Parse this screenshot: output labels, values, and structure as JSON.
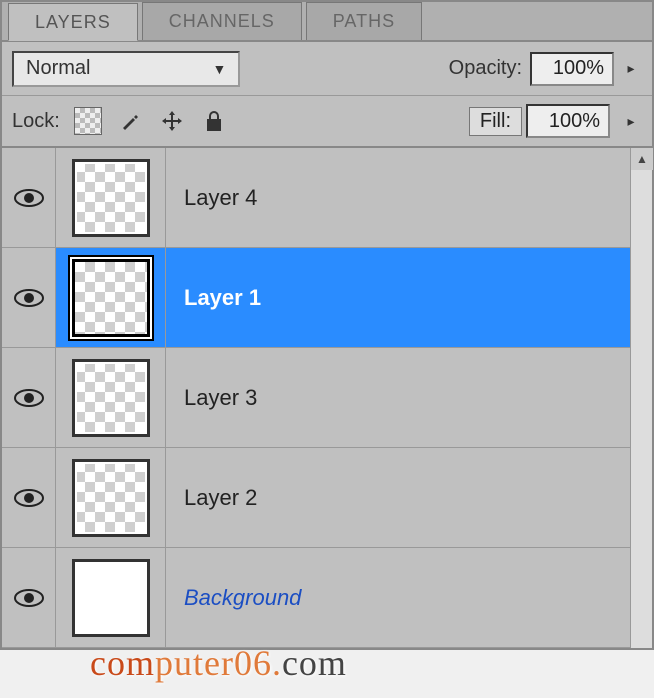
{
  "tabs": {
    "layers": "LAYERS",
    "channels": "CHANNELS",
    "paths": "PATHS"
  },
  "blend": {
    "mode": "Normal",
    "opacity_label": "Opacity:",
    "opacity_value": "100%",
    "lock_label": "Lock:",
    "fill_label": "Fill:",
    "fill_value": "100%"
  },
  "layers": [
    {
      "name": "Layer 4",
      "selected": false,
      "bg": false
    },
    {
      "name": "Layer 1",
      "selected": true,
      "bg": false
    },
    {
      "name": "Layer 3",
      "selected": false,
      "bg": false
    },
    {
      "name": "Layer 2",
      "selected": false,
      "bg": false
    },
    {
      "name": "Background",
      "selected": false,
      "bg": true
    }
  ],
  "watermark": {
    "p1": "com",
    "p2": "puter06",
    "dot": ".",
    "p3": "com"
  }
}
